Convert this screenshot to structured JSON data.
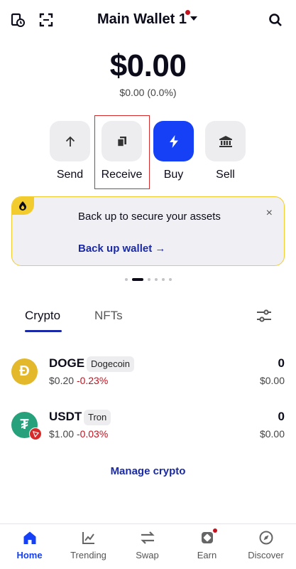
{
  "header": {
    "wallet_name": "Main Wallet 1",
    "icons": [
      "history-icon",
      "scan-icon",
      "search-icon"
    ]
  },
  "balance": {
    "total": "$0.00",
    "change": "$0.00 (0.0%)"
  },
  "actions": [
    {
      "label": "Send",
      "icon": "arrow-up-icon"
    },
    {
      "label": "Receive",
      "icon": "copy-icon"
    },
    {
      "label": "Buy",
      "icon": "lightning-icon"
    },
    {
      "label": "Sell",
      "icon": "bank-icon"
    }
  ],
  "backup_card": {
    "message": "Back up to secure your assets",
    "link": "Back up wallet →",
    "close": "×"
  },
  "pager": {
    "count": 6,
    "active_index": 1
  },
  "tabs": [
    {
      "label": "Crypto",
      "active": true
    },
    {
      "label": "NFTs",
      "active": false
    }
  ],
  "assets": [
    {
      "symbol": "DOGE",
      "tag": "Dogecoin",
      "price": "$0.20",
      "change": "-0.23%",
      "quantity": "0",
      "fiat": "$0.00",
      "icon_letter": "Ð",
      "color": "#e3b82b"
    },
    {
      "symbol": "USDT",
      "tag": "Tron",
      "price": "$1.00",
      "change": "-0.03%",
      "quantity": "0",
      "fiat": "$0.00",
      "icon_letter": "₮",
      "color": "#26a17b"
    }
  ],
  "manage_label": "Manage crypto",
  "bottom_nav": [
    {
      "label": "Home",
      "icon": "home-icon",
      "active": true
    },
    {
      "label": "Trending",
      "icon": "trending-icon",
      "active": false
    },
    {
      "label": "Swap",
      "icon": "swap-icon",
      "active": false
    },
    {
      "label": "Earn",
      "icon": "earn-icon",
      "active": false,
      "dot": true
    },
    {
      "label": "Discover",
      "icon": "discover-icon",
      "active": false
    }
  ],
  "colors": {
    "accent": "#1540f5",
    "link": "#1a2aa6",
    "negative": "#c4121f",
    "warning": "#f2cc2e"
  }
}
